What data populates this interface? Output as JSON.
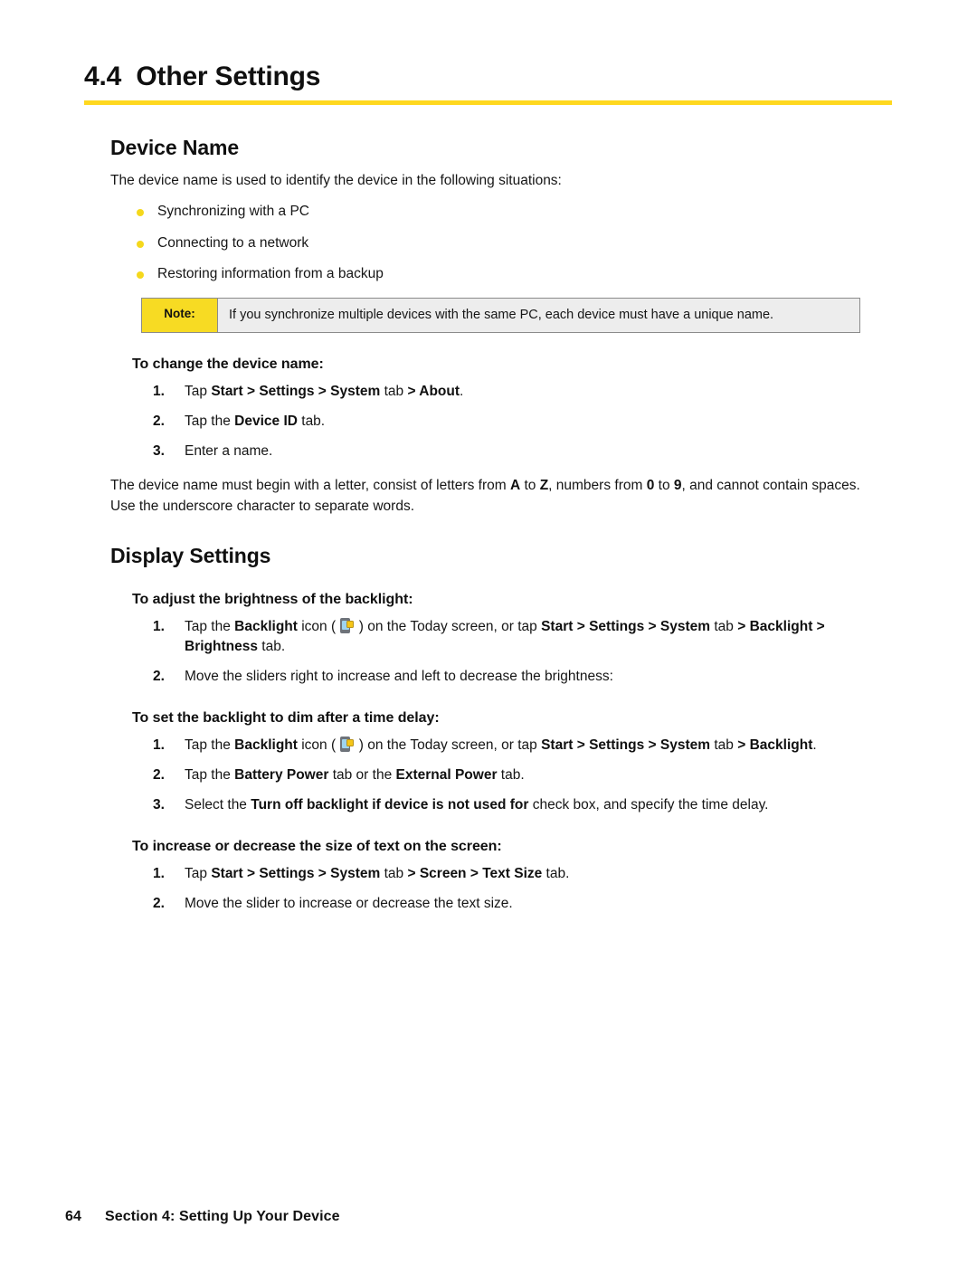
{
  "section": {
    "number": "4.4",
    "title": "Other Settings",
    "rule_color": "#FFD81F"
  },
  "device_name": {
    "heading": "Device Name",
    "intro": "The device name is used to identify the device in the following situations:",
    "bullets": [
      "Synchronizing with a PC",
      "Connecting to a network",
      "Restoring information from a backup"
    ],
    "note": {
      "label": "Note:",
      "text": "If you synchronize multiple devices with the same PC, each device must have a unique name.",
      "label_color": "#F7DB23",
      "body_color": "#EDEDED"
    },
    "procedure_heading": "To change the device name:",
    "steps": [
      {
        "num": "1.",
        "parts": [
          {
            "t": "Tap ",
            "b": false
          },
          {
            "t": "Start",
            "b": true
          },
          {
            "t": " > ",
            "b": true
          },
          {
            "t": "Settings",
            "b": true
          },
          {
            "t": " > ",
            "b": true
          },
          {
            "t": "System",
            "b": true
          },
          {
            "t": " tab ",
            "b": false
          },
          {
            "t": "> ",
            "b": true
          },
          {
            "t": "About",
            "b": true
          },
          {
            "t": ".",
            "b": false
          }
        ]
      },
      {
        "num": "2.",
        "parts": [
          {
            "t": "Tap the ",
            "b": false
          },
          {
            "t": "Device ID",
            "b": true
          },
          {
            "t": " tab.",
            "b": false
          }
        ]
      },
      {
        "num": "3.",
        "parts": [
          {
            "t": "Enter a name.",
            "b": false
          }
        ]
      }
    ],
    "rules_paragraph_parts": [
      {
        "t": "The device name must begin with a letter, consist of letters from ",
        "b": false
      },
      {
        "t": "A",
        "b": true
      },
      {
        "t": " to ",
        "b": false
      },
      {
        "t": "Z",
        "b": true
      },
      {
        "t": ", numbers from ",
        "b": false
      },
      {
        "t": "0",
        "b": true
      },
      {
        "t": " to ",
        "b": false
      },
      {
        "t": "9",
        "b": true
      },
      {
        "t": ", and cannot contain spaces. Use the underscore character to separate words.",
        "b": false
      }
    ]
  },
  "display_settings": {
    "heading": "Display Settings",
    "procedures": [
      {
        "heading": "To adjust the brightness of the backlight:",
        "steps": [
          {
            "num": "1.",
            "parts": [
              {
                "t": "Tap the ",
                "b": false
              },
              {
                "t": "Backlight",
                "b": true
              },
              {
                "t": " icon ( ",
                "b": false
              },
              {
                "icon": "backlight-icon"
              },
              {
                "t": " ) on the Today screen, or tap ",
                "b": false
              },
              {
                "t": "Start",
                "b": true
              },
              {
                "t": " > ",
                "b": true
              },
              {
                "t": "Settings",
                "b": true
              },
              {
                "t": " > ",
                "b": true
              },
              {
                "t": "System",
                "b": true
              },
              {
                "t": " tab ",
                "b": false
              },
              {
                "t": "> ",
                "b": true
              },
              {
                "t": "Backlight",
                "b": true
              },
              {
                "t": " > ",
                "b": true
              },
              {
                "t": "Brightness",
                "b": true
              },
              {
                "t": " tab.",
                "b": false
              }
            ]
          },
          {
            "num": "2.",
            "parts": [
              {
                "t": "Move the sliders right to increase and left to decrease the brightness:",
                "b": false
              }
            ]
          }
        ]
      },
      {
        "heading": "To set the backlight to dim after a time delay:",
        "steps": [
          {
            "num": "1.",
            "parts": [
              {
                "t": "Tap the ",
                "b": false
              },
              {
                "t": "Backlight",
                "b": true
              },
              {
                "t": " icon ( ",
                "b": false
              },
              {
                "icon": "backlight-icon"
              },
              {
                "t": " ) on the Today screen, or tap ",
                "b": false
              },
              {
                "t": "Start",
                "b": true
              },
              {
                "t": " > ",
                "b": true
              },
              {
                "t": "Settings",
                "b": true
              },
              {
                "t": " > ",
                "b": true
              },
              {
                "t": "System",
                "b": true
              },
              {
                "t": " tab ",
                "b": false
              },
              {
                "t": "> ",
                "b": true
              },
              {
                "t": "Backlight",
                "b": true
              },
              {
                "t": ".",
                "b": false
              }
            ]
          },
          {
            "num": "2.",
            "parts": [
              {
                "t": "Tap the ",
                "b": false
              },
              {
                "t": "Battery Power",
                "b": true
              },
              {
                "t": " tab or the ",
                "b": false
              },
              {
                "t": "External Power",
                "b": true
              },
              {
                "t": " tab.",
                "b": false
              }
            ]
          },
          {
            "num": "3.",
            "parts": [
              {
                "t": "Select the ",
                "b": false
              },
              {
                "t": "Turn off backlight if device is not used for",
                "b": true
              },
              {
                "t": " check box, and specify the time delay.",
                "b": false
              }
            ]
          }
        ]
      },
      {
        "heading": "To increase or decrease the size of text on the screen:",
        "steps": [
          {
            "num": "1.",
            "parts": [
              {
                "t": "Tap ",
                "b": false
              },
              {
                "t": "Start",
                "b": true
              },
              {
                "t": " > ",
                "b": true
              },
              {
                "t": "Settings",
                "b": true
              },
              {
                "t": " > ",
                "b": true
              },
              {
                "t": "System",
                "b": true
              },
              {
                "t": " tab ",
                "b": false
              },
              {
                "t": "> ",
                "b": true
              },
              {
                "t": "Screen",
                "b": true
              },
              {
                "t": " > ",
                "b": true
              },
              {
                "t": "Text Size",
                "b": true
              },
              {
                "t": " tab.",
                "b": false
              }
            ]
          },
          {
            "num": "2.",
            "parts": [
              {
                "t": "Move the slider to increase or decrease the text size.",
                "b": false
              }
            ]
          }
        ]
      }
    ]
  },
  "footer": {
    "page_number": "64",
    "text": "Section 4: Setting Up Your Device"
  }
}
